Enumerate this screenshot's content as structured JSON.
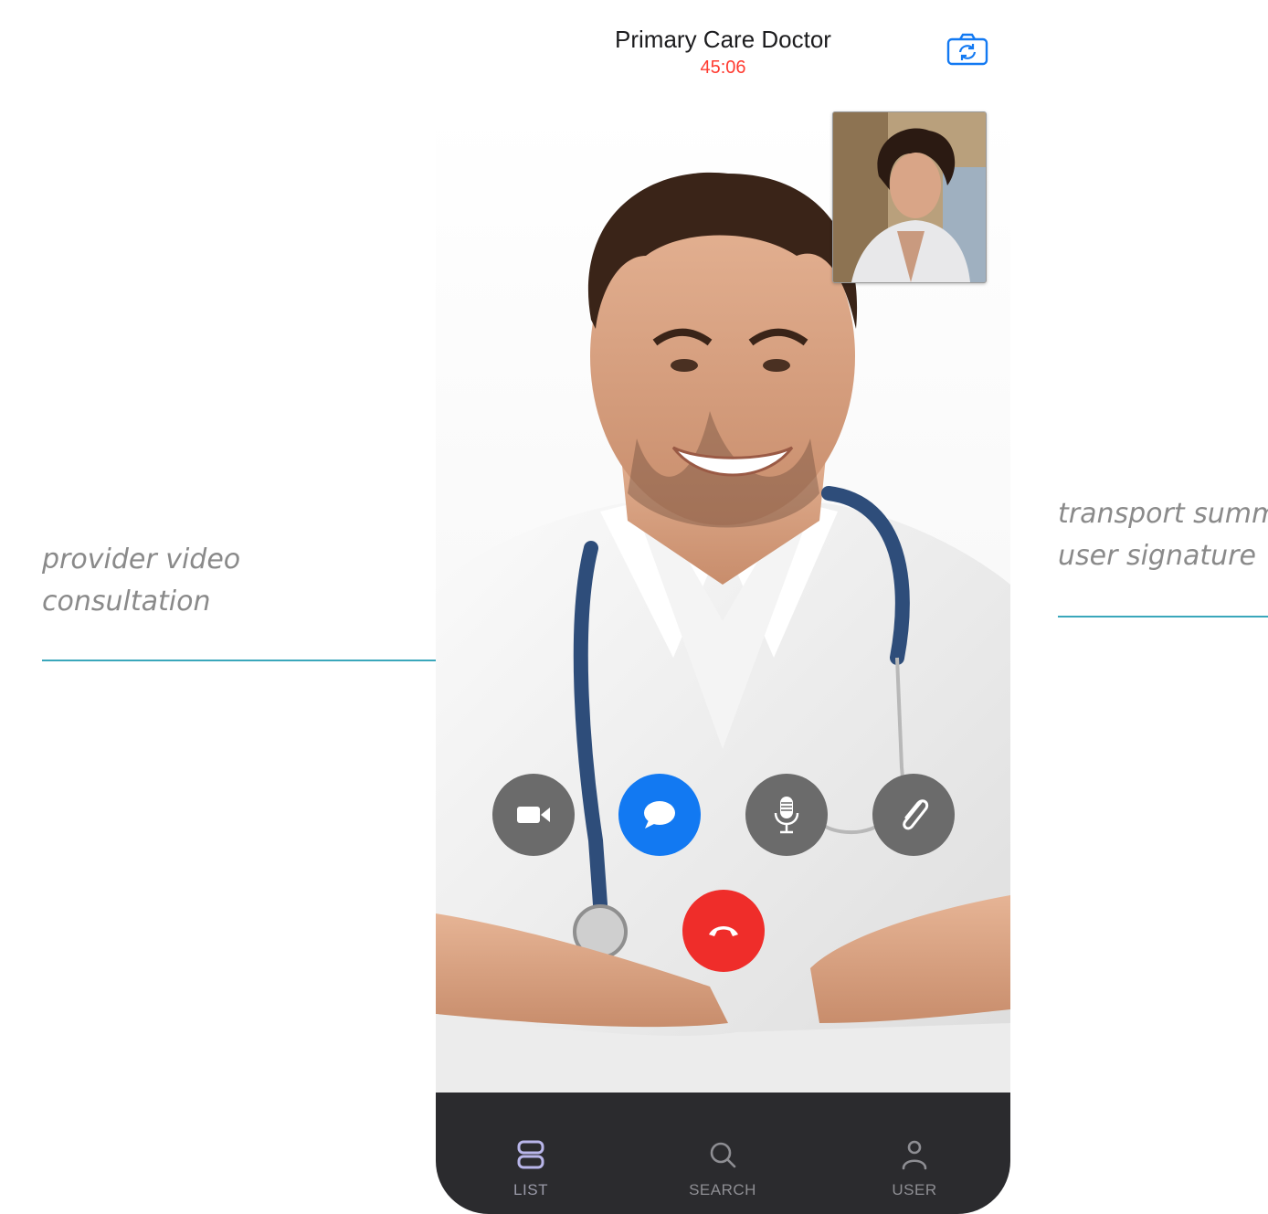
{
  "annotations": {
    "left_line1": "provider video",
    "left_line2": "consultation",
    "right_line1": "transport summ",
    "right_line2": "user signature"
  },
  "call": {
    "title": "Primary Care Doctor",
    "timer": "45:06",
    "timer_color": "#ff3b30"
  },
  "controls": {
    "video": "video-camera-icon",
    "chat": "chat-bubble-icon",
    "mic": "microphone-icon",
    "attach": "paperclip-icon",
    "end_call": "end-call-icon"
  },
  "tabbar": {
    "tabs": [
      {
        "label": "LIST",
        "icon": "list-icon"
      },
      {
        "label": "SEARCH",
        "icon": "search-icon"
      },
      {
        "label": "USER",
        "icon": "user-icon"
      }
    ]
  },
  "colors": {
    "accent_line": "#3aa7bb",
    "chat_blue": "#1279f2",
    "end_call_red": "#ef2d2a",
    "control_gray": "#6b6b6b",
    "tabbar_bg": "#2b2b2e"
  }
}
